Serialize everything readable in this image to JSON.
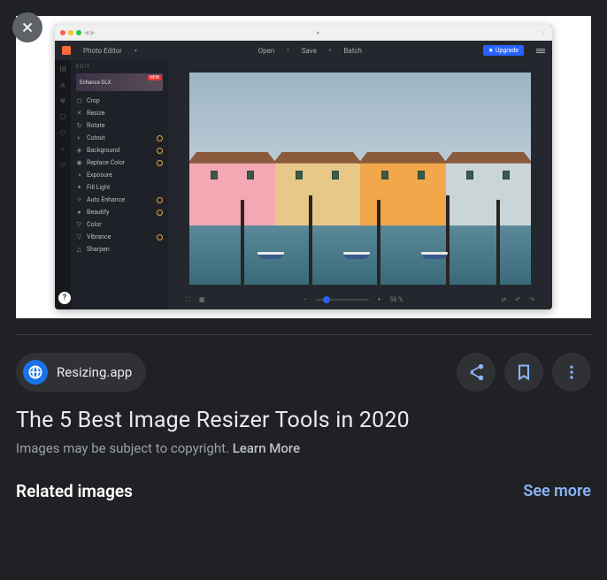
{
  "source": {
    "name": "Resizing.app"
  },
  "title": "The 5 Best Image Resizer Tools in 2020",
  "copyright_notice": "Images may be subject to copyright. ",
  "learn_more": "Learn More",
  "related_label": "Related images",
  "see_more": "See more",
  "app": {
    "title": "Photo Editor",
    "menu": {
      "open": "Open",
      "save": "Save",
      "batch": "Batch"
    },
    "upgrade": "Upgrade",
    "section": "EDIT",
    "enhance_card": "Enhance DLX",
    "new_badge": "NEW",
    "zoom_pct": "56 %",
    "tools": [
      {
        "label": "Crop",
        "gold": false
      },
      {
        "label": "Resize",
        "gold": false
      },
      {
        "label": "Rotate",
        "gold": false
      },
      {
        "label": "Cutout",
        "gold": true
      },
      {
        "label": "Background",
        "gold": true
      },
      {
        "label": "Replace Color",
        "gold": true
      },
      {
        "label": "Exposure",
        "gold": false
      },
      {
        "label": "Fill Light",
        "gold": false
      },
      {
        "label": "Auto Enhance",
        "gold": true
      },
      {
        "label": "Beautify",
        "gold": true
      },
      {
        "label": "Color",
        "gold": false
      },
      {
        "label": "Vibrance",
        "gold": true
      },
      {
        "label": "Sharpen",
        "gold": false
      }
    ]
  }
}
